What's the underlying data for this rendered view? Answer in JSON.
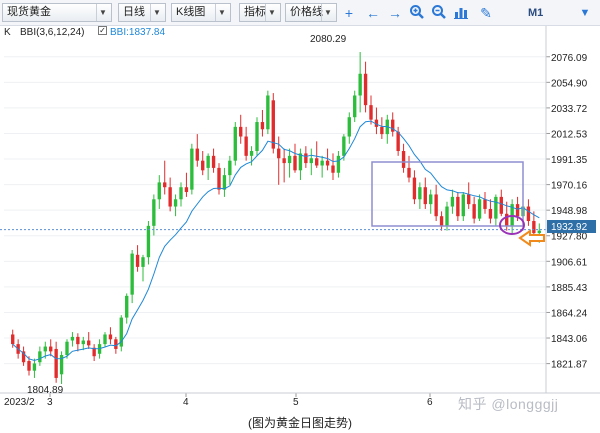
{
  "toolbar": {
    "symbol": "现货黄金",
    "period": "日线",
    "chart_type": "K线图",
    "indicator": "指标",
    "price_line": "价格线",
    "mode": "M1",
    "icons": [
      "crosshair-icon",
      "arrow-left-icon",
      "arrow-right-icon",
      "zoom-in-icon",
      "zoom-out-icon",
      "chart-icon",
      "draw-icon",
      "menu-icon"
    ]
  },
  "legend": {
    "k_label": "K",
    "bbi_params": "BBI(3,6,12,24)",
    "bbi_value": "BBI:1837.84",
    "bbi_color": "#1e88d8"
  },
  "chart_data": {
    "type": "candlestick",
    "y_ticks": [
      "2076.09",
      "2054.90",
      "2033.72",
      "2012.53",
      "1991.35",
      "1970.16",
      "1948.98",
      "1927.80",
      "1906.61",
      "1885.43",
      "1864.24",
      "1843.06",
      "1821.87"
    ],
    "y_range": [
      1800,
      2085
    ],
    "x_labels": [
      "2023/2",
      "3",
      "4",
      "5",
      "6"
    ],
    "current_price": "1932.92",
    "high_label": "2080.29",
    "low_label": "1804.89",
    "up_color": "#2dbd3c",
    "down_color": "#e02c2c",
    "candles": [
      [
        1846,
        1850,
        1835,
        1838
      ],
      [
        1838,
        1842,
        1826,
        1830
      ],
      [
        1832,
        1836,
        1820,
        1823
      ],
      [
        1824,
        1828,
        1812,
        1816
      ],
      [
        1816,
        1826,
        1810,
        1822
      ],
      [
        1823,
        1836,
        1820,
        1832
      ],
      [
        1832,
        1840,
        1826,
        1836
      ],
      [
        1836,
        1842,
        1828,
        1832
      ],
      [
        1834,
        1840,
        1806,
        1810
      ],
      [
        1813,
        1832,
        1805,
        1829
      ],
      [
        1829,
        1842,
        1826,
        1840
      ],
      [
        1841,
        1848,
        1836,
        1844
      ],
      [
        1844,
        1847,
        1832,
        1838
      ],
      [
        1838,
        1844,
        1833,
        1841
      ],
      [
        1841,
        1848,
        1834,
        1837
      ],
      [
        1835,
        1838,
        1824,
        1828
      ],
      [
        1830,
        1842,
        1826,
        1838
      ],
      [
        1838,
        1848,
        1836,
        1846
      ],
      [
        1846,
        1852,
        1838,
        1842
      ],
      [
        1842,
        1844,
        1830,
        1834
      ],
      [
        1836,
        1862,
        1832,
        1860
      ],
      [
        1860,
        1880,
        1855,
        1878
      ],
      [
        1879,
        1916,
        1872,
        1913
      ],
      [
        1912,
        1920,
        1898,
        1902
      ],
      [
        1902,
        1912,
        1890,
        1910
      ],
      [
        1910,
        1940,
        1904,
        1936
      ],
      [
        1936,
        1962,
        1928,
        1958
      ],
      [
        1958,
        1978,
        1950,
        1972
      ],
      [
        1972,
        1990,
        1962,
        1968
      ],
      [
        1968,
        1976,
        1948,
        1952
      ],
      [
        1952,
        1962,
        1944,
        1958
      ],
      [
        1958,
        1972,
        1952,
        1968
      ],
      [
        1968,
        1980,
        1960,
        1964
      ],
      [
        1966,
        2004,
        1962,
        2000
      ],
      [
        2000,
        2012,
        1985,
        1990
      ],
      [
        1990,
        1998,
        1978,
        1982
      ],
      [
        1984,
        1996,
        1974,
        1994
      ],
      [
        1994,
        2000,
        1980,
        1984
      ],
      [
        1984,
        1988,
        1962,
        1966
      ],
      [
        1966,
        1984,
        1960,
        1978
      ],
      [
        1978,
        1994,
        1970,
        1990
      ],
      [
        1990,
        2022,
        1986,
        2018
      ],
      [
        2018,
        2028,
        2004,
        2010
      ],
      [
        2010,
        2018,
        1990,
        1994
      ],
      [
        1994,
        2002,
        1986,
        1998
      ],
      [
        1998,
        2026,
        1994,
        2022
      ],
      [
        2022,
        2032,
        2010,
        2016
      ],
      [
        2016,
        2048,
        2012,
        2044
      ],
      [
        2040,
        2046,
        1996,
        2000
      ],
      [
        2000,
        2010,
        1970,
        1992
      ],
      [
        1992,
        2000,
        1972,
        1988
      ],
      [
        1988,
        2000,
        1976,
        1994
      ],
      [
        1994,
        2004,
        1980,
        1982
      ],
      [
        1982,
        2000,
        1974,
        1996
      ],
      [
        1996,
        2002,
        1984,
        1988
      ],
      [
        1988,
        2000,
        1978,
        1992
      ],
      [
        1992,
        2006,
        1984,
        1986
      ],
      [
        1986,
        1994,
        1976,
        1990
      ],
      [
        1990,
        2000,
        1982,
        1986
      ],
      [
        1986,
        1996,
        1974,
        1980
      ],
      [
        1980,
        1998,
        1976,
        1994
      ],
      [
        1994,
        2012,
        1990,
        2010
      ],
      [
        2010,
        2030,
        2004,
        2026
      ],
      [
        2026,
        2048,
        2022,
        2044
      ],
      [
        2044,
        2080,
        2030,
        2062
      ],
      [
        2062,
        2072,
        2030,
        2036
      ],
      [
        2036,
        2044,
        2020,
        2024
      ],
      [
        2024,
        2034,
        2012,
        2018
      ],
      [
        2018,
        2026,
        2008,
        2012
      ],
      [
        2012,
        2028,
        2004,
        2024
      ],
      [
        2024,
        2030,
        2010,
        2014
      ],
      [
        2014,
        2018,
        1994,
        1998
      ],
      [
        1998,
        2004,
        1980,
        1984
      ],
      [
        1984,
        1994,
        1972,
        1976
      ],
      [
        1976,
        1982,
        1954,
        1958
      ],
      [
        1958,
        1972,
        1950,
        1968
      ],
      [
        1968,
        1976,
        1950,
        1954
      ],
      [
        1954,
        1966,
        1946,
        1962
      ],
      [
        1962,
        1970,
        1940,
        1944
      ],
      [
        1944,
        1948,
        1932,
        1936
      ],
      [
        1936,
        1956,
        1932,
        1952
      ],
      [
        1952,
        1966,
        1946,
        1960
      ],
      [
        1960,
        1964,
        1940,
        1944
      ],
      [
        1944,
        1964,
        1940,
        1962
      ],
      [
        1962,
        1972,
        1950,
        1954
      ],
      [
        1954,
        1960,
        1938,
        1942
      ],
      [
        1942,
        1962,
        1940,
        1958
      ],
      [
        1958,
        1964,
        1946,
        1950
      ],
      [
        1950,
        1958,
        1938,
        1942
      ],
      [
        1942,
        1962,
        1936,
        1960
      ],
      [
        1960,
        1966,
        1944,
        1946
      ],
      [
        1946,
        1956,
        1932,
        1936
      ],
      [
        1936,
        1958,
        1930,
        1954
      ],
      [
        1954,
        1960,
        1940,
        1944
      ],
      [
        1944,
        1956,
        1932,
        1952
      ],
      [
        1952,
        1958,
        1936,
        1940
      ],
      [
        1940,
        1948,
        1926,
        1930
      ],
      [
        1930,
        1938,
        1922,
        1932
      ]
    ]
  },
  "caption": "(图为黄金日图走势)",
  "watermark": "知乎 @longggjj"
}
